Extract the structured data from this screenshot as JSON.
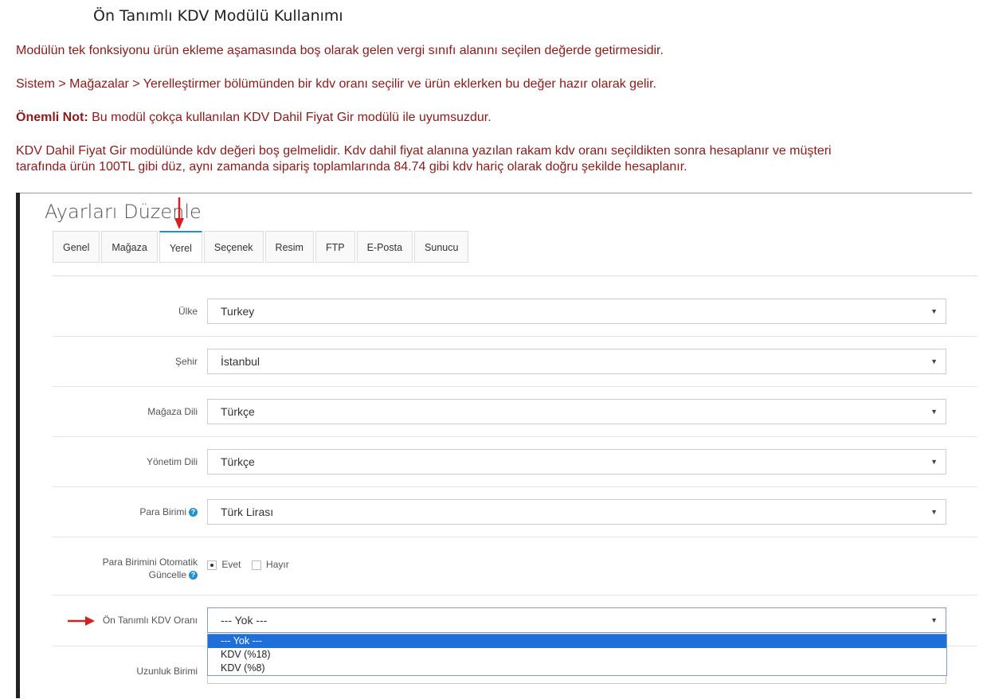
{
  "doc": {
    "title": "Ön Tanımlı KDV Modülü Kullanımı",
    "p1": "Modülün tek fonksiyonu ürün ekleme aşamasında boş olarak gelen vergi sınıfı alanını seçilen değerde getirmesidir.",
    "p2": "Sistem > Mağazalar > Yerelleştirmer bölümünden bir kdv oranı seçilir ve ürün eklerken bu değer hazır olarak gelir.",
    "note_label": "Önemli Not:",
    "note_text": " Bu modül çokça kullanılan KDV Dahil Fiyat Gir modülü ile uyumsuzdur.",
    "p3_line1": "KDV Dahil Fiyat Gir modülünde kdv değeri boş gelmelidir. Kdv dahil fiyat alanına yazılan rakam kdv oranı seçildikten sonra hesaplanır ve müşteri",
    "p3_line2": "tarafında ürün 100TL gibi düz, aynı zamanda sipariş toplamlarında 84.74 gibi kdv hariç olarak doğru şekilde hesaplanır."
  },
  "panel": {
    "title": "Ayarları Düzenle",
    "tabs": [
      "Genel",
      "Mağaza",
      "Yerel",
      "Seçenek",
      "Resim",
      "FTP",
      "E-Posta",
      "Sunucu"
    ],
    "active_tab": "Yerel"
  },
  "form": {
    "country_label": "Ülke",
    "country_value": "Turkey",
    "city_label": "Şehir",
    "city_value": "İstanbul",
    "store_lang_label": "Mağaza Dili",
    "store_lang_value": "Türkçe",
    "admin_lang_label": "Yönetim Dili",
    "admin_lang_value": "Türkçe",
    "currency_label": "Para Birimi",
    "currency_value": "Türk Lirası",
    "auto_update_label_1": "Para Birimini Otomatik",
    "auto_update_label_2": "Güncelle",
    "yes_label": "Evet",
    "no_label": "Hayır",
    "vat_label": "Ön Tanımlı KDV Oranı",
    "vat_value": "--- Yok ---",
    "vat_options": [
      "--- Yok ---",
      "KDV (%18)",
      "KDV (%8)"
    ],
    "length_label": "Uzunluk Birimi"
  },
  "colors": {
    "accent": "#1e91cf",
    "text_red": "#8b1a1a",
    "arrow": "#d32020",
    "selected": "#1e6fd9"
  }
}
